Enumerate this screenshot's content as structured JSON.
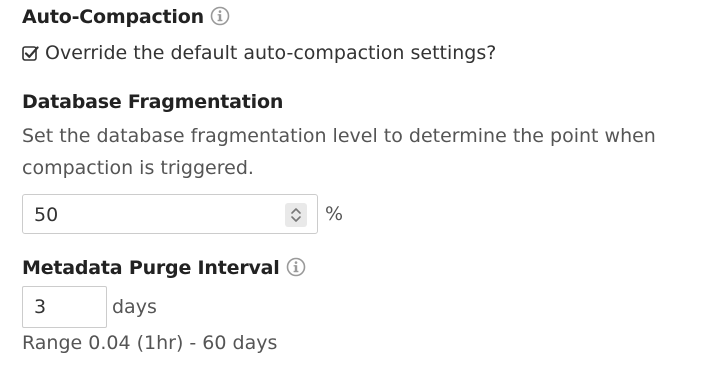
{
  "auto_compaction": {
    "title": "Auto-Compaction",
    "override_label": "Override the default auto-compaction settings?",
    "override_checked": true
  },
  "fragmentation": {
    "heading": "Database Fragmentation",
    "description": "Set the database fragmentation level to determine the point when compaction is triggered.",
    "value": "50",
    "unit": "%"
  },
  "purge": {
    "heading": "Metadata Purge Interval",
    "value": "3",
    "unit": "days",
    "range": "Range 0.04 (1hr) - 60 days"
  },
  "icons": {
    "info": "info-icon",
    "checkbox": "checkbox-checked-icon",
    "spinner": "spinner-arrows-icon"
  }
}
